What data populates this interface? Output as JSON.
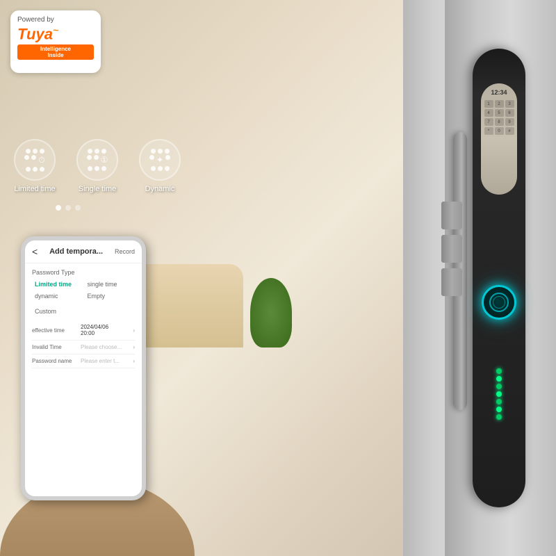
{
  "branding": {
    "powered_by": "Powered by",
    "logo_text": "Tuya",
    "logo_wave": "~",
    "badge_text": "Intelligence\nInside"
  },
  "features": [
    {
      "label": "Limited time",
      "icon": "⏱"
    },
    {
      "label": "Single time",
      "icon": "1️⃣"
    },
    {
      "label": "Dynamic",
      "icon": "✦"
    }
  ],
  "app": {
    "header": {
      "back": "<",
      "title": "Add tempora...",
      "record": "Record"
    },
    "section_label": "Password Type",
    "password_types": [
      {
        "label": "Limited time",
        "selected": true
      },
      {
        "label": "single time",
        "selected": false
      },
      {
        "label": "dynamic",
        "selected": false
      },
      {
        "label": "Empty",
        "selected": false
      },
      {
        "label": "Custom",
        "selected": false
      }
    ],
    "fields": [
      {
        "label": "effective time",
        "value": "2024/04/06\n20:00",
        "type": "value"
      },
      {
        "label": "Invalid Time",
        "value": "Please choose...",
        "type": "placeholder"
      },
      {
        "label": "Password name",
        "value": "Please enter t...",
        "type": "placeholder"
      }
    ]
  },
  "lock": {
    "time": "12:34",
    "keypad_numbers": [
      "1",
      "2",
      "3",
      "4",
      "5",
      "6",
      "7",
      "8",
      "9",
      "*",
      "0",
      "#"
    ]
  },
  "dots": [
    {
      "active": true
    },
    {
      "active": false
    },
    {
      "active": false
    }
  ]
}
